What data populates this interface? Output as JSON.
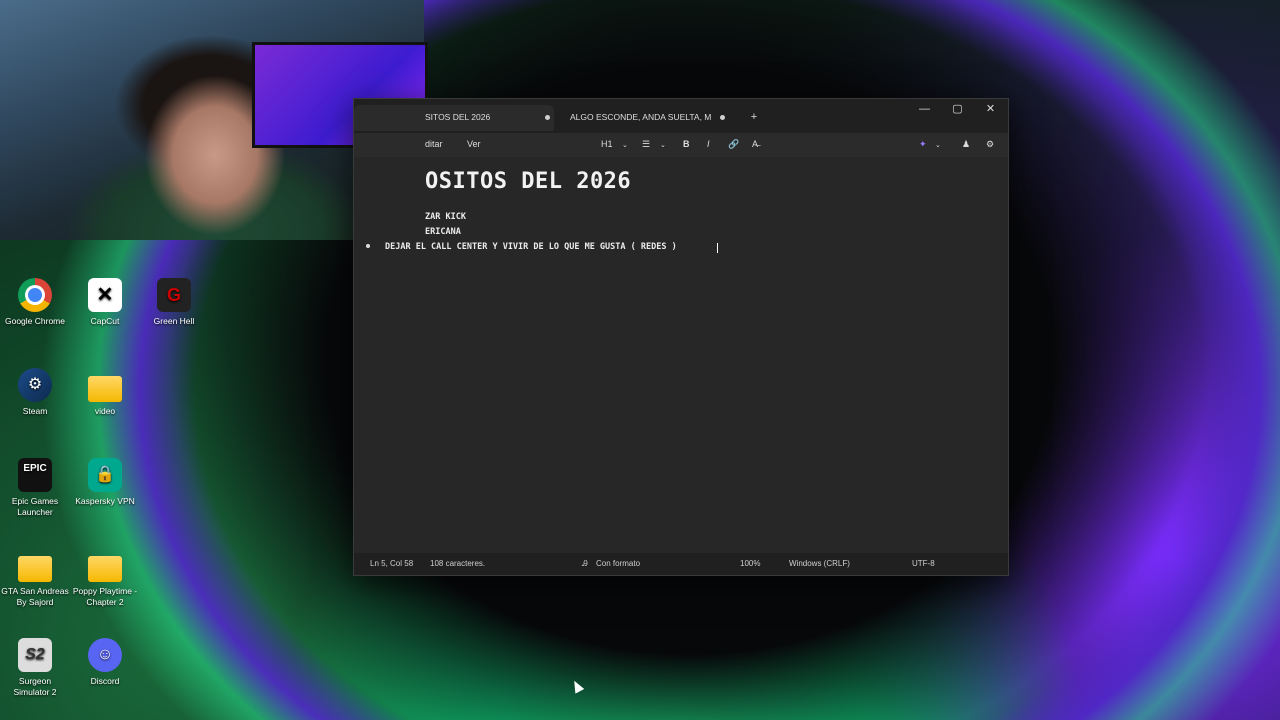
{
  "desktop": {
    "icons": [
      {
        "label": "Google Chrome",
        "icon": "chrome-icon"
      },
      {
        "label": "CapCut",
        "icon": "capcut-icon"
      },
      {
        "label": "Green Hell",
        "icon": "green-hell-icon"
      },
      {
        "label": "Steam",
        "icon": "steam-icon"
      },
      {
        "label": "video",
        "icon": "folder-icon"
      },
      {
        "label": "Epic Games Launcher",
        "icon": "epic-games-icon"
      },
      {
        "label": "Kaspersky VPN",
        "icon": "kaspersky-vpn-icon"
      },
      {
        "label": "GTA San Andreas By Sajord",
        "icon": "folder-icon"
      },
      {
        "label": "Poppy Playtime - Chapter 2",
        "icon": "folder-icon"
      },
      {
        "label": "Surgeon Simulator 2",
        "icon": "surgeon-simulator-icon"
      },
      {
        "label": "Discord",
        "icon": "discord-icon"
      }
    ],
    "glyphs": {
      "capcut": "✕",
      "greenhell": "G",
      "steam": "⚙",
      "epic": "EPIC",
      "kaspersky": "🔒",
      "surgeon": "S2",
      "discord": "☺"
    }
  },
  "notepad": {
    "tabs": [
      {
        "title": "SITOS DEL 2026"
      },
      {
        "title": "ALGO ESCONDE, ANDA SUELTA, MIR"
      }
    ],
    "new_tab_glyph": "+",
    "window_buttons": {
      "minimize": "—",
      "maximize": "▢",
      "close": "✕"
    },
    "menu": {
      "edit": "ditar",
      "view": "Ver"
    },
    "toolbar": {
      "heading": "H1",
      "list": "☰",
      "bold": "B",
      "italic": "I",
      "link": "🔗",
      "clear": "A̶",
      "copilot": "✦",
      "account": "♟",
      "settings": "⚙"
    },
    "document": {
      "title": "OSITOS DEL 2026",
      "lines": [
        "ZAR KICK",
        "ERICANA",
        "DEJAR EL CALL CENTER Y VIVIR DE LO QUE ME GUSTA ( REDES )"
      ]
    },
    "status": {
      "position": "Ln 5, Col 58",
      "chars": "108 caracteres.",
      "format": "Con formato",
      "zoom": "100%",
      "line_ending": "Windows (CRLF)",
      "encoding": "UTF-8"
    }
  }
}
